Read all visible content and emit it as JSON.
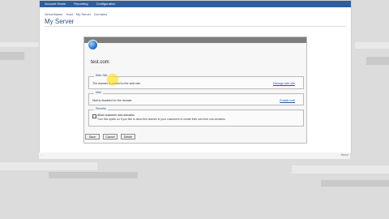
{
  "topnav": {
    "items": [
      "Account Home",
      "Reporting",
      "Configuration"
    ]
  },
  "breadcrumb": [
    "ServerName",
    "Host",
    "My Server",
    "Domains"
  ],
  "page": {
    "title": "My Server"
  },
  "dialog": {
    "domain": "test.com",
    "web_site": {
      "label": "Web Site",
      "text": "The domain is parked to the web site.",
      "link": "Manage web site"
    },
    "mail": {
      "label": "Mail",
      "text": "Mail is disabled for the domain.",
      "link": "Enable mail"
    },
    "security": {
      "label": "Security",
      "checkbox_label": "Allow customer sub-domains",
      "checkbox_desc": "Turn this option on if you like to allow this domain to your customers to create their own free sub-domains."
    },
    "buttons": [
      "Save",
      "Cancel",
      "Delete"
    ]
  },
  "footer": {
    "left": "...",
    "right": "About"
  }
}
